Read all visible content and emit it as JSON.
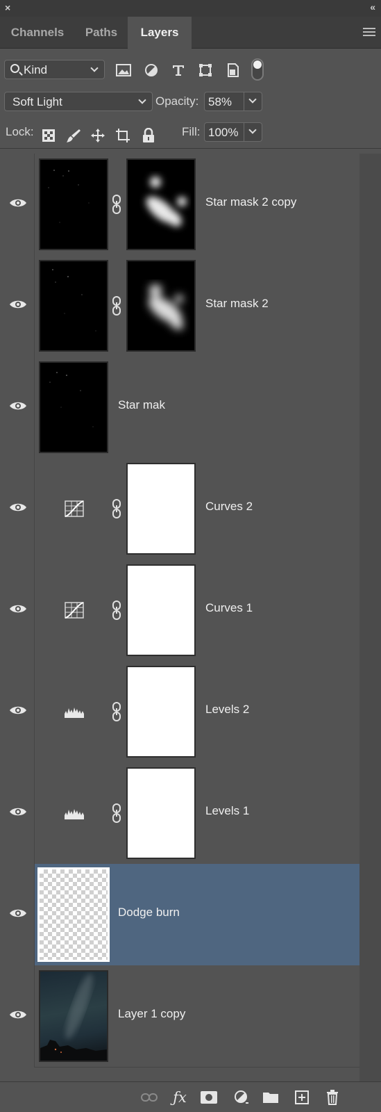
{
  "panel": {
    "close_icon": "×",
    "collapse_icon": "«",
    "tabs": [
      {
        "label": "Channels",
        "active": false
      },
      {
        "label": "Paths",
        "active": false
      },
      {
        "label": "Layers",
        "active": true
      }
    ]
  },
  "filter": {
    "kind_label": "Kind",
    "icons": [
      "image-filter-icon",
      "adjustment-filter-icon",
      "type-filter-icon",
      "shape-filter-icon",
      "smart-object-filter-icon"
    ]
  },
  "blend": {
    "mode": "Soft Light",
    "opacity_label": "Opacity:",
    "opacity_value": "58%",
    "fill_label": "Fill:",
    "fill_value": "100%",
    "lock_label": "Lock:"
  },
  "layers": [
    {
      "name": "Star mask 2 copy",
      "type": "pixel-with-mask",
      "selected": false
    },
    {
      "name": "Star mask 2",
      "type": "pixel-with-mask",
      "selected": false
    },
    {
      "name": "Star mak",
      "type": "pixel",
      "selected": false
    },
    {
      "name": "Curves 2",
      "type": "curves",
      "selected": false
    },
    {
      "name": "Curves 1",
      "type": "curves",
      "selected": false
    },
    {
      "name": "Levels 2",
      "type": "levels",
      "selected": false
    },
    {
      "name": "Levels 1",
      "type": "levels",
      "selected": false
    },
    {
      "name": "Dodge burn",
      "type": "transparent",
      "selected": true
    },
    {
      "name": "Layer 1 copy",
      "type": "photo",
      "selected": false
    }
  ],
  "colors": {
    "panel_bg": "#535353",
    "selected_row": "#4f6680",
    "tab_bar": "#3d3d3d"
  },
  "footer_icons": [
    "link-layers-icon",
    "fx-icon",
    "add-mask-icon",
    "adjustment-layer-icon",
    "group-folder-icon",
    "new-layer-icon",
    "trash-icon"
  ]
}
